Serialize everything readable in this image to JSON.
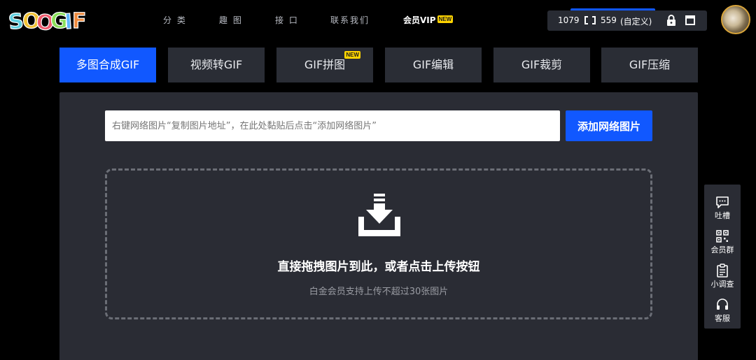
{
  "nav": {
    "logo_text": "SOOGIF",
    "items": [
      "分 类",
      "趣 图",
      "接 口",
      "联系我们"
    ],
    "vip_label": "会员VIP",
    "vip_badge": "NEW"
  },
  "size_panel": {
    "width": "1079",
    "height": "559",
    "mode": "(自定义)",
    "link_icon": "link-ratio-icon",
    "lock_icon": "lock-icon",
    "window_icon": "window-icon"
  },
  "tabs": [
    {
      "label": "多图合成GIF",
      "active": true
    },
    {
      "label": "视频转GIF"
    },
    {
      "label": "GIF拼图",
      "badge": "NEW"
    },
    {
      "label": "GIF编辑"
    },
    {
      "label": "GIF裁剪"
    },
    {
      "label": "GIF压缩"
    }
  ],
  "url_input": {
    "placeholder": "右键网络图片“复制图片地址”，在此处黏贴后点击“添加网络图片”",
    "value": ""
  },
  "add_button": "添加网络图片",
  "dropzone": {
    "icon": "download-tray-icon",
    "title": "直接拖拽图片到此，或者点击上传按钮",
    "subtitle": "白金会员支持上传不超过30张图片"
  },
  "sidebar": [
    {
      "label": "吐槽",
      "icon": "chat-bubble-icon"
    },
    {
      "label": "会员群",
      "icon": "qr-code-icon"
    },
    {
      "label": "小调查",
      "icon": "clipboard-icon"
    },
    {
      "label": "客服",
      "icon": "headset-icon"
    }
  ],
  "colors": {
    "accent": "#1158ff",
    "badge": "#ffd400",
    "panel": "#2a2c34",
    "background": "#000000"
  }
}
